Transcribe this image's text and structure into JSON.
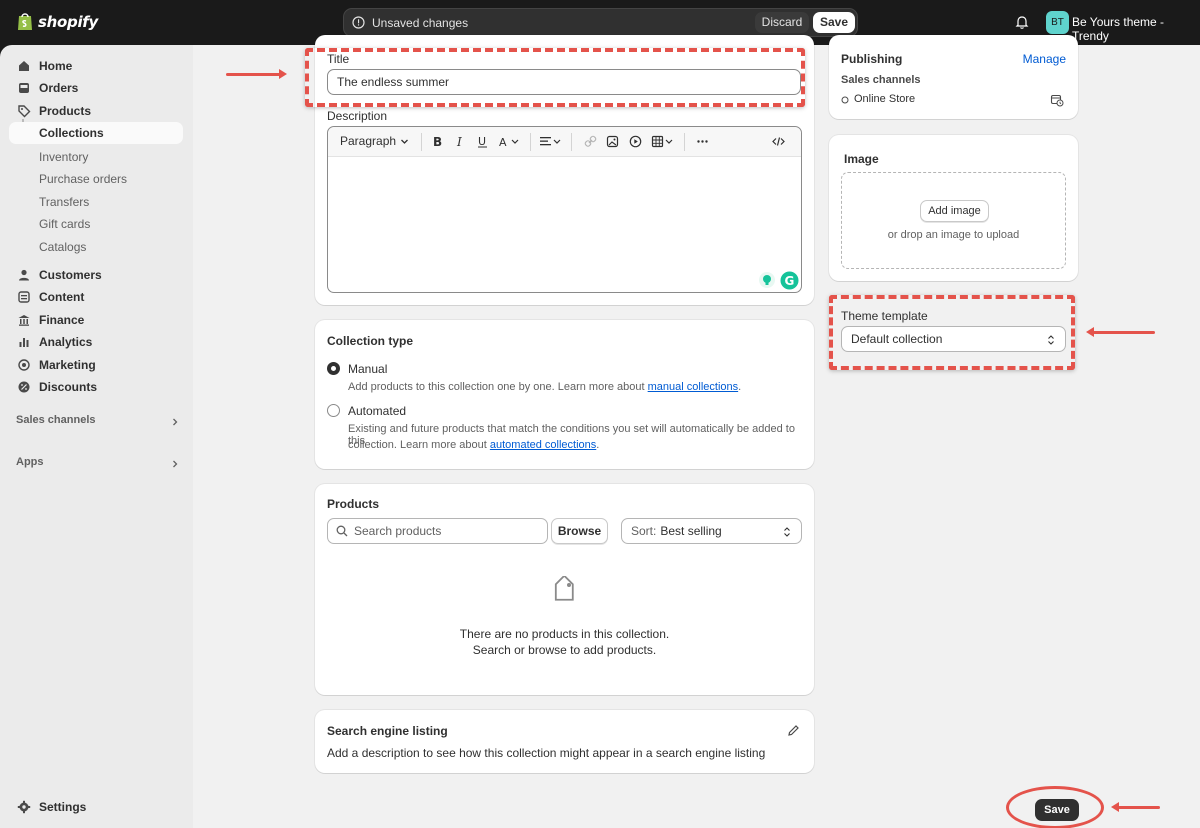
{
  "topbar": {
    "logo_text": "shopify",
    "unsaved_text": "Unsaved changes",
    "discard_label": "Discard",
    "save_label": "Save",
    "avatar_initials": "BT",
    "store_name": "Be Yours theme - Trendy"
  },
  "sidebar": {
    "items": [
      {
        "label": "Home"
      },
      {
        "label": "Orders"
      },
      {
        "label": "Products"
      },
      {
        "label": "Collections"
      },
      {
        "label": "Inventory"
      },
      {
        "label": "Purchase orders"
      },
      {
        "label": "Transfers"
      },
      {
        "label": "Gift cards"
      },
      {
        "label": "Catalogs"
      },
      {
        "label": "Customers"
      },
      {
        "label": "Content"
      },
      {
        "label": "Finance"
      },
      {
        "label": "Analytics"
      },
      {
        "label": "Marketing"
      },
      {
        "label": "Discounts"
      }
    ],
    "sales_channels": "Sales channels",
    "apps": "Apps",
    "settings": "Settings"
  },
  "title_section": {
    "label": "Title",
    "value": "The endless summer",
    "description_label": "Description",
    "paragraph": "Paragraph"
  },
  "collection_type": {
    "heading": "Collection type",
    "manual_label": "Manual",
    "manual_desc": "Add products to this collection one by one. Learn more about ",
    "manual_link": "manual collections",
    "automated_label": "Automated",
    "automated_desc_1": "Existing and future products that match the conditions you set will automatically be added to this",
    "automated_desc_2": "collection. Learn more about ",
    "automated_link": "automated collections",
    "period": "."
  },
  "products": {
    "heading": "Products",
    "search_placeholder": "Search products",
    "browse_label": "Browse",
    "sort_label": "Sort: ",
    "sort_value": "Best selling",
    "empty_line1": "There are no products in this collection.",
    "empty_line2": "Search or browse to add products."
  },
  "seo": {
    "heading": "Search engine listing",
    "desc": "Add a description to see how this collection might appear in a search engine listing"
  },
  "publishing": {
    "heading": "Publishing",
    "manage": "Manage",
    "sales_channels": "Sales channels",
    "online_store": "Online Store"
  },
  "image": {
    "heading": "Image",
    "add_image": "Add image",
    "drop_text": "or drop an image to upload"
  },
  "theme_template": {
    "label": "Theme template",
    "value": "Default collection"
  },
  "footer": {
    "save_label": "Save"
  },
  "colors": {
    "accent_red": "#e4534b",
    "link_blue": "#005bd3",
    "topbar": "#1a1a1a",
    "avatar": "#5fd3cd"
  }
}
